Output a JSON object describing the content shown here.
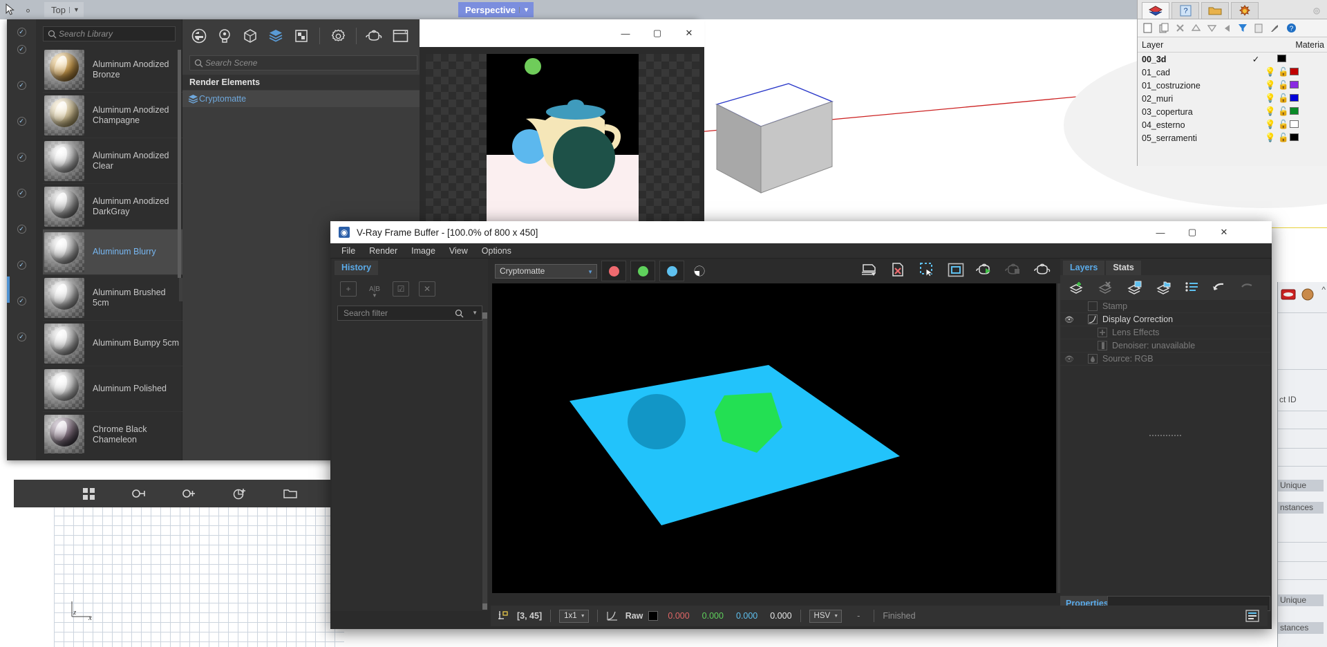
{
  "rhino": {
    "viewport_tabs": [
      {
        "label": "Top",
        "active": false
      },
      {
        "label": "Perspective",
        "active": true
      }
    ],
    "axis_x": "x",
    "axis_z": "z"
  },
  "layer_panel": {
    "tabs": [
      "layers-tab-icon",
      "help-tab-icon",
      "folder-tab-icon",
      "sun-tab-icon"
    ],
    "tools": [
      "new-layer-icon",
      "copy-layer-icon",
      "delete-layer-icon",
      "move-up-icon",
      "move-down-icon",
      "back-icon",
      "filter-icon",
      "page-icon",
      "tools-icon",
      "help-icon"
    ],
    "columns": [
      "Layer",
      "Materia"
    ],
    "rows": [
      {
        "name": "00_3d",
        "current": true,
        "bold": true,
        "light": false,
        "lock": false,
        "color": "#000000"
      },
      {
        "name": "01_cad",
        "current": false,
        "bold": false,
        "light": true,
        "lock": true,
        "color": "#c00000"
      },
      {
        "name": "01_costruzione",
        "current": false,
        "bold": false,
        "light": true,
        "lock": true,
        "color": "#8a2be2"
      },
      {
        "name": "02_muri",
        "current": false,
        "bold": false,
        "light": true,
        "lock": true,
        "color": "#0000d8"
      },
      {
        "name": "03_copertura",
        "current": false,
        "bold": false,
        "light": true,
        "lock": true,
        "color": "#0a8a28"
      },
      {
        "name": "04_esterno",
        "current": false,
        "bold": false,
        "light": true,
        "lock": true,
        "color": "#ffffff"
      },
      {
        "name": "05_serramenti",
        "current": false,
        "bold": false,
        "light": true,
        "lock": true,
        "color": "#000000"
      }
    ]
  },
  "properties_strip": {
    "object_id_label": "ct ID",
    "unique_1": "Unique",
    "instances_1": "nstances",
    "unique_2": "Unique",
    "instances_2": "stances"
  },
  "asset_editor": {
    "library_search_placeholder": "Search Library",
    "materials": [
      {
        "name": "Aluminum Anodized Bronze",
        "selected": false,
        "color": "#b08a4a"
      },
      {
        "name": "Aluminum Anodized Champagne",
        "selected": false,
        "color": "#c8b68c"
      },
      {
        "name": "Aluminum Anodized Clear",
        "selected": false,
        "color": "#cfcfcf"
      },
      {
        "name": "Aluminum Anodized DarkGray",
        "selected": false,
        "color": "#9a9a9a"
      },
      {
        "name": "Aluminum Blurry",
        "selected": true,
        "color": "#bdbdbd"
      },
      {
        "name": "Aluminum Brushed 5cm",
        "selected": false,
        "color": "#c4c4c4"
      },
      {
        "name": "Aluminum Bumpy 5cm",
        "selected": false,
        "color": "#bfbfbf"
      },
      {
        "name": "Aluminum Polished",
        "selected": false,
        "color": "#d2d2d2"
      },
      {
        "name": "Chrome Black Chameleon",
        "selected": false,
        "color": "#6e5a6a"
      }
    ],
    "toolbar_icons": [
      "materials-icon",
      "lights-icon",
      "geometry-icon",
      "render-elements-icon",
      "textures-icon",
      "settings-icon",
      "teapot-preview-icon",
      "render-window-icon"
    ],
    "scene_search_placeholder": "Search Scene",
    "render_elements_header": "Render Elements",
    "render_element": "Cryptomatte",
    "bottom_icons": [
      "grid-view-icon",
      "duplicate-icon",
      "add-material-icon",
      "add-preset-icon",
      "open-folder-icon",
      "save-icon",
      "delete-icon"
    ],
    "preview": {
      "minimize": "minimize-icon",
      "maximize": "maximize-icon",
      "close": "close-icon",
      "eye": "eye-icon"
    }
  },
  "vfb": {
    "title": "V-Ray Frame Buffer - [100.0% of 800 x 450]",
    "window_buttons": [
      "minimize-icon",
      "maximize-icon",
      "close-icon"
    ],
    "menu": [
      "File",
      "Render",
      "Image",
      "View",
      "Options"
    ],
    "history": {
      "tab": "History",
      "tools": [
        "add-snapshot-icon",
        "compare-ab-icon",
        "select-all-icon",
        "clear-icon"
      ],
      "search_placeholder": "Search filter"
    },
    "channel": {
      "selected": "Cryptomatte",
      "rgb_buttons": [
        {
          "name": "red-channel-button",
          "color": "#ef6a6f"
        },
        {
          "name": "green-channel-button",
          "color": "#5fd15c"
        },
        {
          "name": "blue-channel-button",
          "color": "#5ec0ef"
        }
      ],
      "alpha_button": "alpha-channel-button"
    },
    "tools": [
      "save-image-icon",
      "clear-image-icon",
      "region-select-icon",
      "render-region-icon",
      "render-last-icon",
      "stop-render-icon",
      "vray-teapot-icon"
    ],
    "status": {
      "pixel_coords": "[3, 45]",
      "sampling": "1x1",
      "curve_icon": "curve-icon",
      "raw_label": "Raw",
      "swatch": "#000000",
      "values": [
        {
          "v": "0.000",
          "color": "#e06666"
        },
        {
          "v": "0.000",
          "color": "#5fd15c"
        },
        {
          "v": "0.000",
          "color": "#5ec0ef"
        },
        {
          "v": "0.000",
          "color": "#e8e8e8"
        }
      ],
      "color_mode": "HSV",
      "dash": "-",
      "message": "Finished",
      "log_icon": "log-icon"
    },
    "layers_panel": {
      "tabs": [
        {
          "label": "Layers",
          "active": true
        },
        {
          "label": "Stats",
          "active": false
        }
      ],
      "tools": [
        "add-layer-icon",
        "delete-layer-icon",
        "save-layer-icon",
        "load-layer-icon",
        "list-icon",
        "undo-icon",
        "redo-icon"
      ],
      "rows": [
        {
          "label": "Stamp",
          "eye": false,
          "dim": true,
          "icon": "stamp-icon"
        },
        {
          "label": "Display Correction",
          "eye": true,
          "dim": false,
          "icon": "curve-icon"
        },
        {
          "label": "Lens Effects",
          "eye": false,
          "dim": true,
          "icon": "plus-icon"
        },
        {
          "label": "Denoiser: unavailable",
          "eye": false,
          "dim": true,
          "icon": "denoiser-icon"
        },
        {
          "label": "Source: RGB",
          "eye": true,
          "dim": true,
          "icon": "source-icon"
        }
      ],
      "properties_label": "Properties"
    }
  }
}
